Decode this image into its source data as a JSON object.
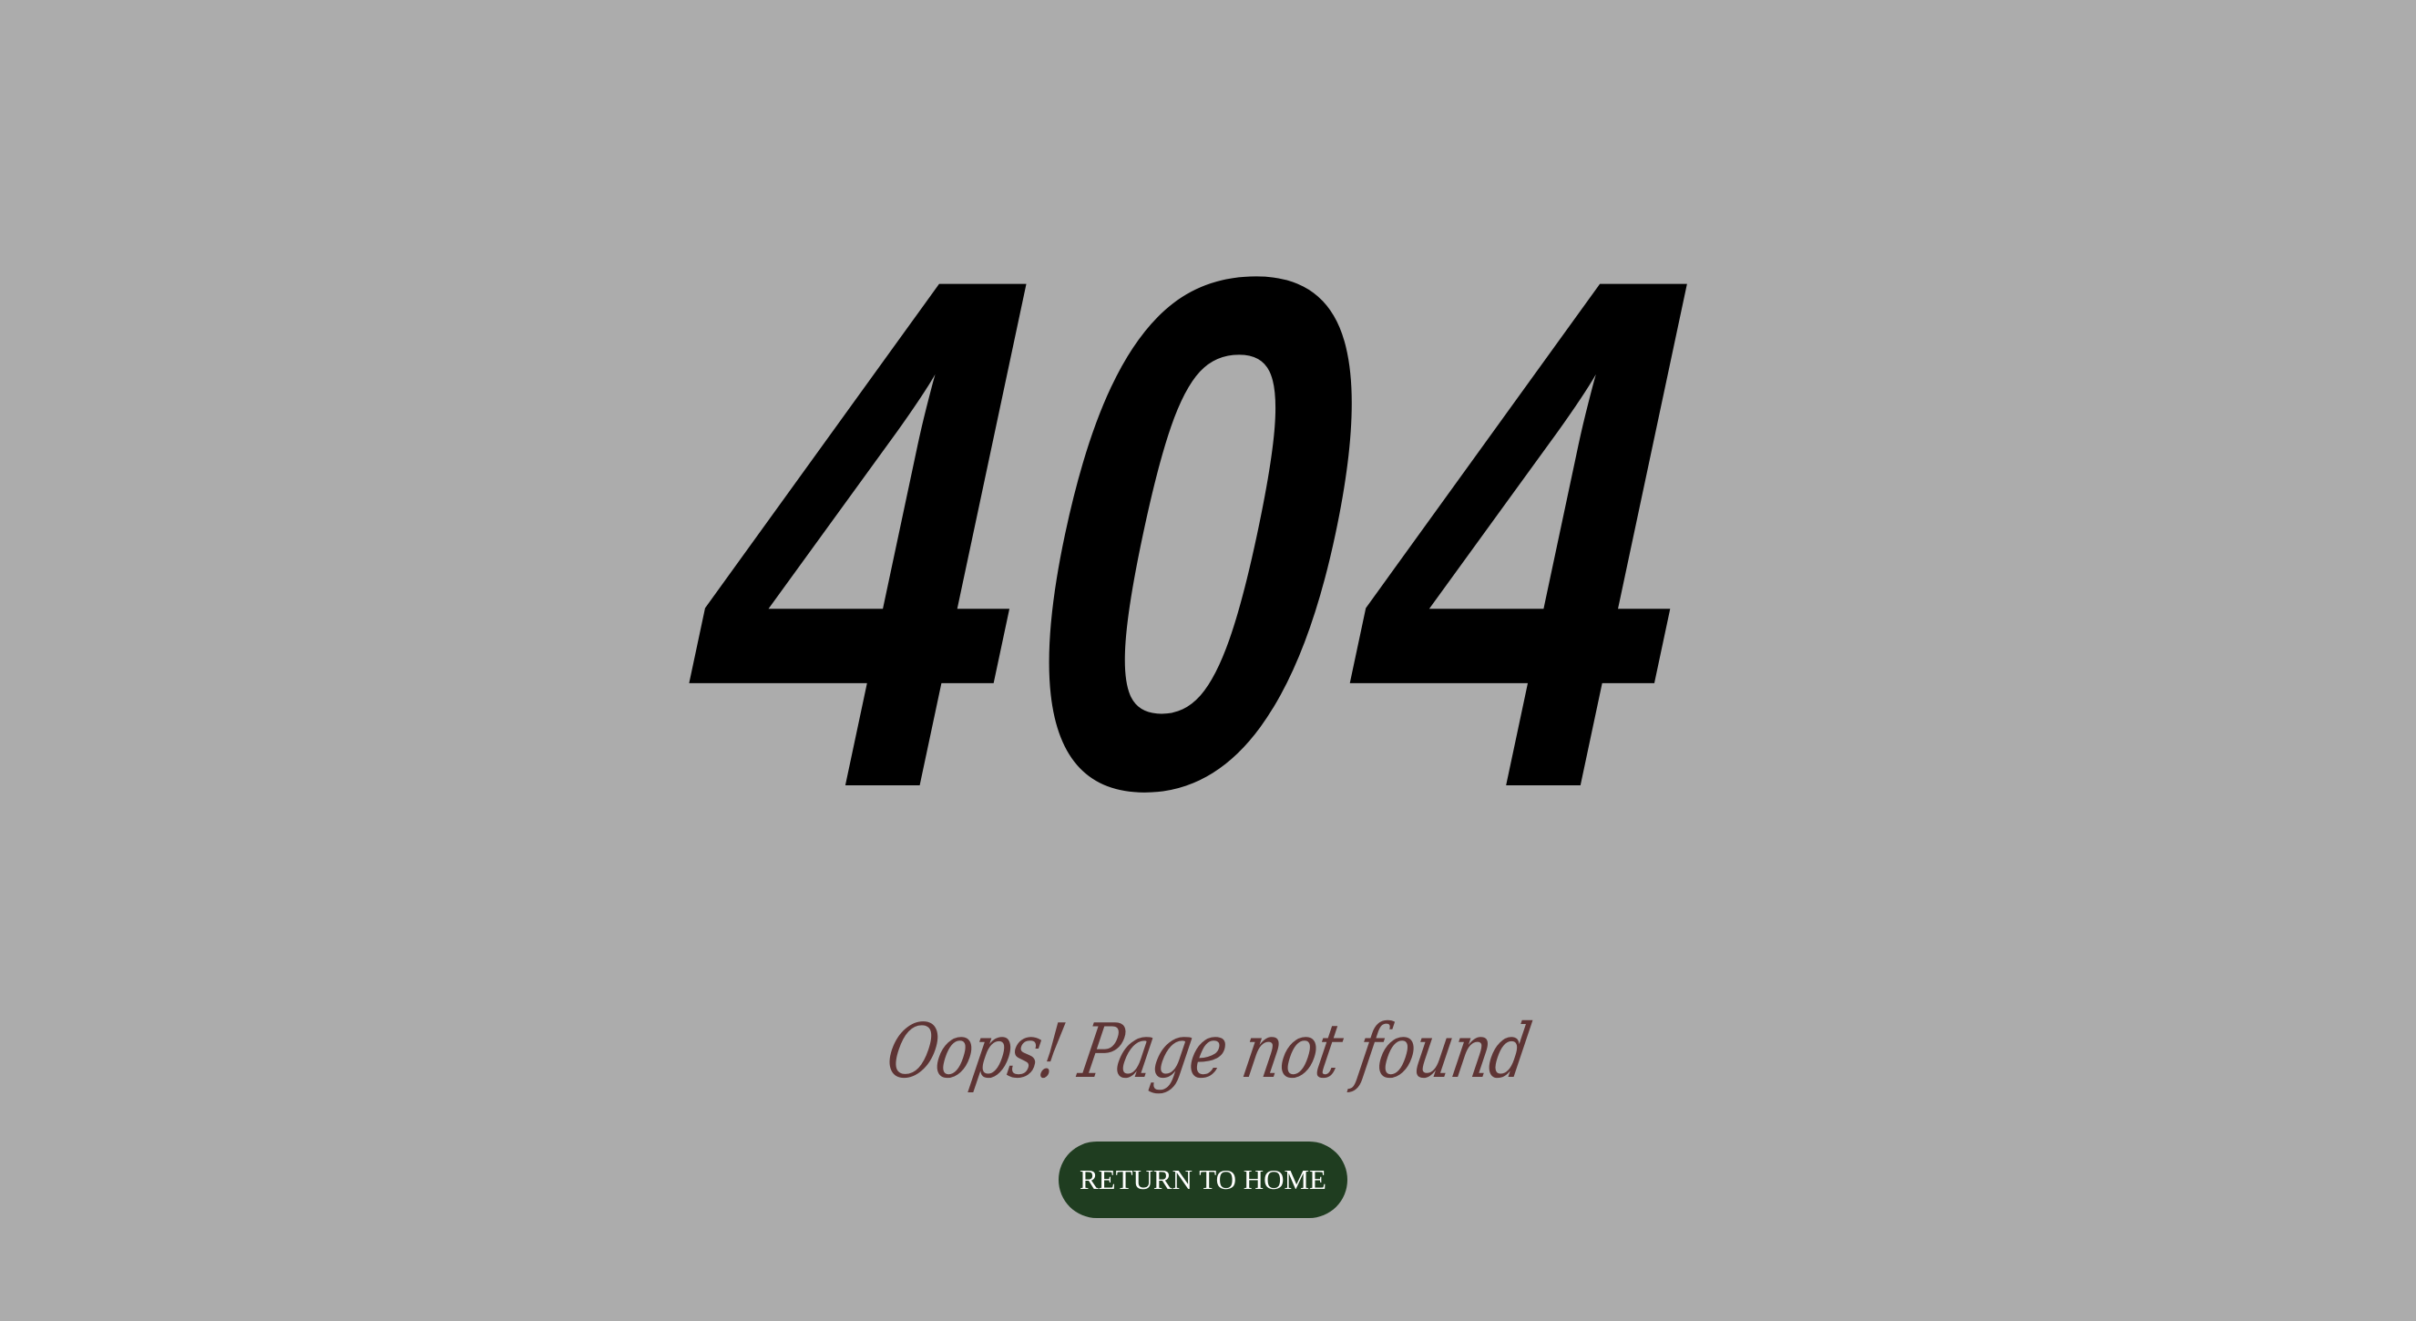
{
  "colors": {
    "background": "#acacac",
    "code": "#000000",
    "message": "#5e3434",
    "button_bg": "#1f3d20",
    "button_text": "#ffffff"
  },
  "error": {
    "code": "404",
    "message": "Oops! Page not found"
  },
  "actions": {
    "home_label": "RETURN TO HOME"
  }
}
